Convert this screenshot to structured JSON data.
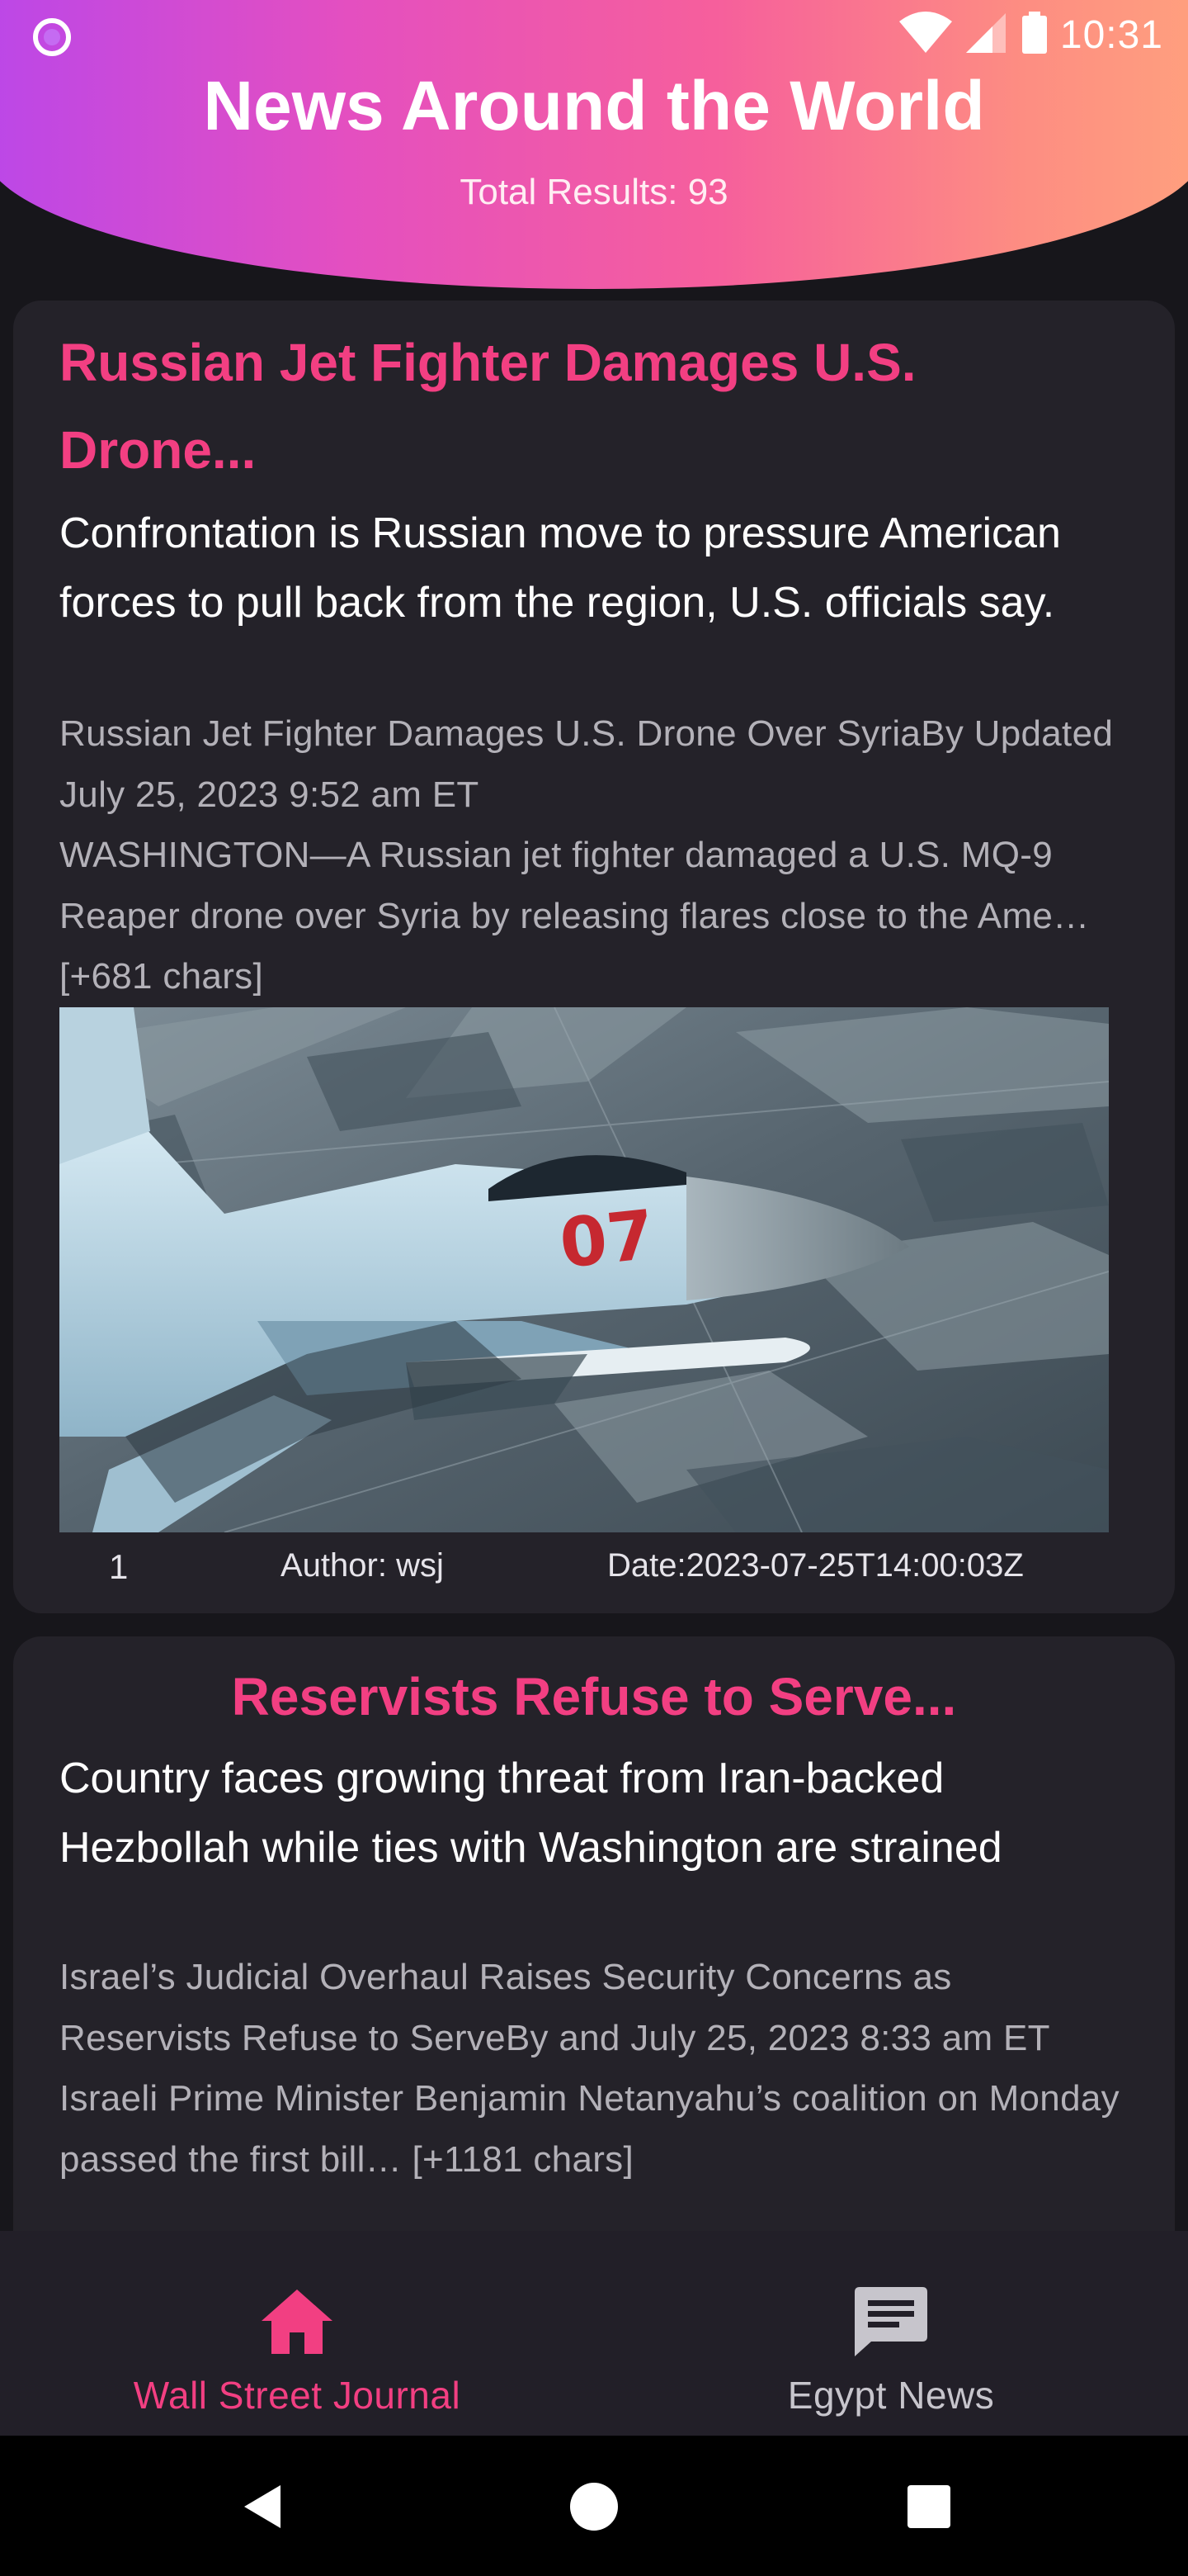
{
  "status_bar": {
    "time": "10:31",
    "icons": [
      "app-notification-dot-icon",
      "wifi-icon",
      "cellular-signal-icon",
      "battery-icon"
    ]
  },
  "header": {
    "title": "News Around the World",
    "subtitle": "Total Results: 93"
  },
  "articles": [
    {
      "title": "Russian Jet Fighter Damages U.S. Drone...",
      "description": "Confrontation is Russian move to pressure American forces to pull back from the region, U.S. officials say.",
      "content": "Russian Jet Fighter Damages U.S. Drone Over SyriaBy Updated July 25, 2023 9:52 am ET\nWASHINGTON—A Russian jet fighter damaged a U.S. MQ-9 Reaper drone over Syria by releasing flares close to the Ame… [+681 chars]",
      "image_icon": "fighter-jet-photo",
      "index": "1",
      "author": "Author: wsj",
      "date": "Date:2023-07-25T14:00:03Z"
    },
    {
      "title": "Reservists Refuse to Serve...",
      "description": "Country faces growing threat from Iran-backed Hezbollah while ties with Washington are strained",
      "content": "Israel’s Judicial Overhaul Raises Security Concerns as Reservists Refuse to ServeBy and July 25, 2023 8:33 am ET\nIsraeli Prime Minister Benjamin Netanyahu’s coalition on Monday passed the first bill… [+1181 chars]"
    }
  ],
  "bottom_nav": {
    "items": [
      {
        "label": "Wall Street Journal",
        "icon": "home-icon",
        "active": true
      },
      {
        "label": "Egypt News",
        "icon": "chat-icon",
        "active": false
      }
    ]
  },
  "colors": {
    "accent": "#f23f82",
    "card_bg": "#242229",
    "page_bg": "#17161b",
    "header_gradient_start": "#bb47e8",
    "header_gradient_end": "#ffa07e"
  }
}
